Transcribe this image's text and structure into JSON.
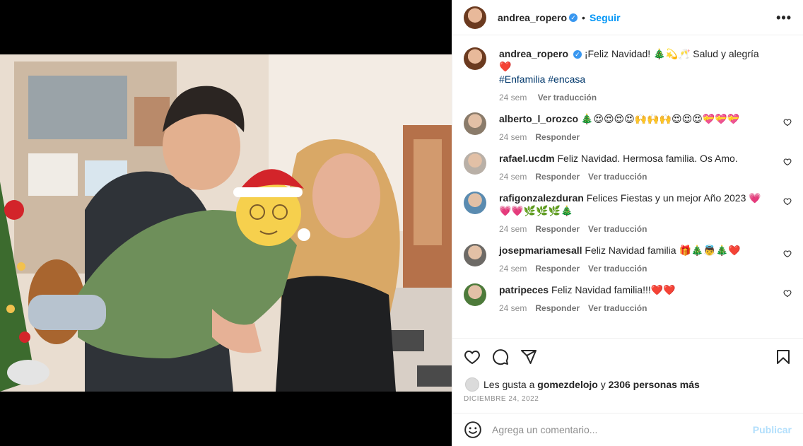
{
  "post": {
    "author": "andrea_ropero",
    "follow_label": "Seguir",
    "more_label": "•••",
    "caption_text": "¡Feliz Navidad! 🎄💫🥂 Salud y alegría ❤️",
    "caption_tags": "#Enfamilia #encasa",
    "caption_time": "24 sem",
    "caption_translate": "Ver traducción"
  },
  "comments": [
    {
      "user": "alberto_l_orozco",
      "text": "🎄😍😍😍😍🙌🙌🙌😍😍😍💝💝💝",
      "time": "24 sem",
      "reply": "Responder",
      "translate": "",
      "avatar_color": "#8a7b6a"
    },
    {
      "user": "rafael.ucdm",
      "text": "Feliz Navidad. Hermosa familia. Os Amo.",
      "time": "24 sem",
      "reply": "Responder",
      "translate": "Ver traducción",
      "avatar_color": "#b9b0a7"
    },
    {
      "user": "rafigonzalezduran",
      "text": "Felices Fiestas y un mejor Año 2023 💗💗💗🌿🌿🌿🎄",
      "time": "24 sem",
      "reply": "Responder",
      "translate": "Ver traducción",
      "avatar_color": "#5a8bb0"
    },
    {
      "user": "josepmariamesall",
      "text": "Feliz Navidad familia 🎁🎄👼🎄❤️",
      "time": "24 sem",
      "reply": "Responder",
      "translate": "Ver traducción",
      "avatar_color": "#6d6a66"
    },
    {
      "user": "patripeces",
      "text": "Feliz Navidad familia!!!❤️❤️",
      "time": "24 sem",
      "reply": "Responder",
      "translate": "Ver traducción",
      "avatar_color": "#4d7a3a"
    }
  ],
  "likes": {
    "prefix": "Les gusta a",
    "user": "gomezdelojo",
    "conj": "y",
    "count": "2306 personas más"
  },
  "date": "DICIEMBRE 24, 2022",
  "add_comment": {
    "placeholder": "Agrega un comentario...",
    "publish": "Publicar"
  },
  "colors": {
    "accent": "#0095f6",
    "verified": "#3897f0",
    "meta": "#8e8e8e"
  }
}
